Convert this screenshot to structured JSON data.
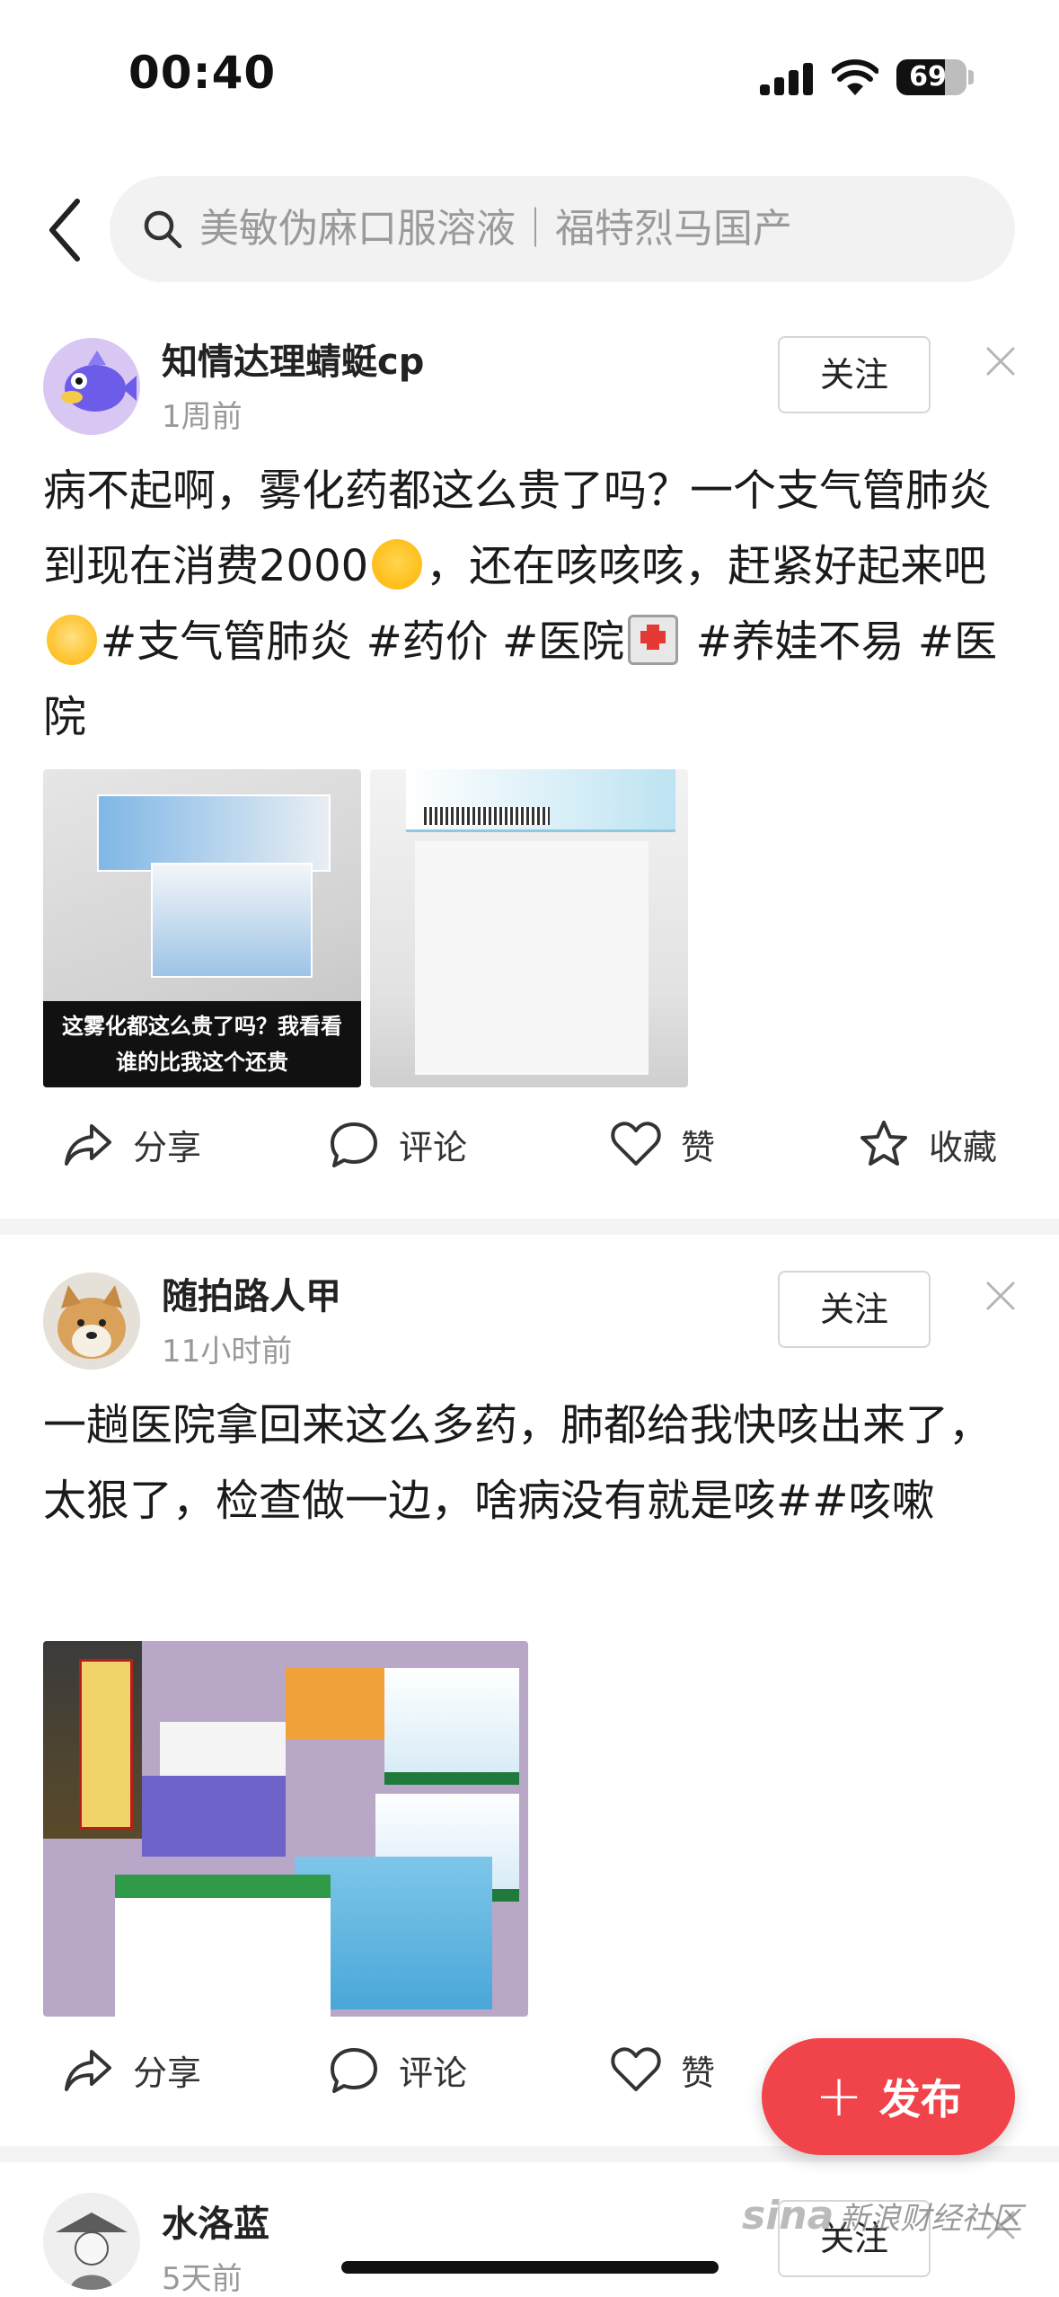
{
  "status_bar": {
    "time": "00:40",
    "battery": "69",
    "battery_level": 0.69
  },
  "search": {
    "query": "美敏伪麻口服溶液｜福特烈马国产"
  },
  "posts": [
    {
      "username": "知情达理蜻蜓cp",
      "time": "1周前",
      "follow_label": "关注",
      "text_parts": [
        "病不起啊，雾化药都这么贵了吗？一个支气管肺炎到现在消费2000",
        "，还在咳咳咳，赶紧好起来吧",
        "#支气管肺炎 #药价 #医院",
        " #养娃不易 #医院"
      ],
      "image_caption": "这雾化都这么贵了吗？我看看谁的比我这个还贵",
      "actions": {
        "share": "分享",
        "comment": "评论",
        "like": "赞",
        "collect": "收藏"
      }
    },
    {
      "username": "随拍路人甲",
      "time": "11小时前",
      "follow_label": "关注",
      "text": "一趟医院拿回来这么多药，肺都给我快咳出来了，太狠了，检查做一边，啥病没有就是咳##咳嗽",
      "actions": {
        "share": "分享",
        "comment": "评论",
        "like": "赞"
      }
    },
    {
      "username": "水洛蓝",
      "time": "5天前",
      "follow_label": "关注"
    }
  ],
  "publish": {
    "label": "发布"
  },
  "watermark": {
    "brand": "sina",
    "text": "新浪财经社区"
  }
}
